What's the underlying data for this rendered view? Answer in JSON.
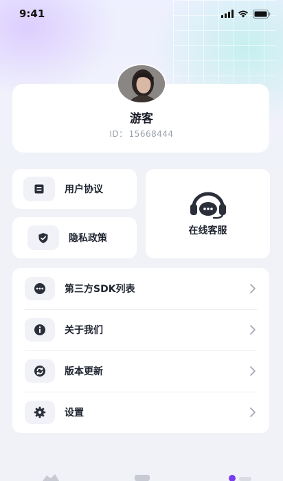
{
  "status_bar": {
    "time": "9:41",
    "icons": [
      "signal-icon",
      "wifi-icon",
      "battery-icon"
    ]
  },
  "profile": {
    "name": "游客",
    "id_label": "ID：",
    "id_value": "15668444"
  },
  "quick_actions": {
    "agreement": {
      "label": "用户协议",
      "icon": "document-icon"
    },
    "privacy": {
      "label": "隐私政策",
      "icon": "shield-icon"
    },
    "service": {
      "label": "在线客服",
      "icon": "headset-icon"
    }
  },
  "menu": [
    {
      "label": "第三方SDK列表",
      "icon": "more-dots-icon"
    },
    {
      "label": "关于我们",
      "icon": "info-icon"
    },
    {
      "label": "版本更新",
      "icon": "refresh-icon"
    },
    {
      "label": "设置",
      "icon": "gear-icon"
    }
  ],
  "colors": {
    "page_bg": "#f1f2f7",
    "card_bg": "#ffffff",
    "icon_fill": "#2a2f3a",
    "icon_bg": "#f1f2f7",
    "muted_text": "#9aa0ab",
    "accent": "#7a3cf0"
  }
}
